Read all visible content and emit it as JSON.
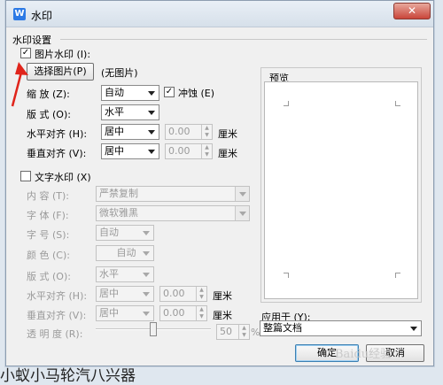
{
  "title": "水印",
  "close_symbol": "✕",
  "app_icon_letter": "W",
  "group_title": "水印设置",
  "picture": {
    "checkbox_label": "图片水印",
    "checkbox_key": "(I):",
    "checked": "✓",
    "select_button": "选择图片",
    "select_key": "(P)",
    "no_picture": "(无图片)",
    "scale_label": "缩 放",
    "scale_key": "(Z):",
    "scale_value": "自动",
    "washout_label": "冲蚀",
    "washout_key": "(E)",
    "layout_label": "版 式",
    "layout_key": "(O):",
    "layout_value": "水平",
    "halign_label": "水平对齐",
    "halign_key": "(H):",
    "halign_value": "居中",
    "halign_offset": "0.00",
    "valign_label": "垂直对齐",
    "valign_key": "(V):",
    "valign_value": "居中",
    "valign_offset": "0.00",
    "unit": "厘米"
  },
  "text": {
    "checkbox_label": "文字水印",
    "checkbox_key": "(X)",
    "content_label": "内 容",
    "content_key": "(T):",
    "content_value": "严禁复制",
    "font_label": "字 体",
    "font_key": "(F):",
    "font_value": "微软雅黑",
    "size_label": "字 号",
    "size_key": "(S):",
    "size_value": "自动",
    "color_label": "颜 色",
    "color_key": "(C):",
    "color_value": "自动",
    "layout_label": "版 式",
    "layout_key": "(O):",
    "layout_value": "水平",
    "halign_label": "水平对齐",
    "halign_key": "(H):",
    "halign_value": "居中",
    "halign_offset": "0.00",
    "valign_label": "垂直对齐",
    "valign_key": "(V):",
    "valign_value": "居中",
    "valign_offset": "0.00",
    "unit": "厘米",
    "transparency_label": "透 明 度",
    "transparency_key": "(R):",
    "transparency_value": "50",
    "transparency_unit": "%",
    "transparency_level": 0.5
  },
  "preview_title": "预览",
  "apply_label": "应用于",
  "apply_key": "(Y):",
  "apply_value": "整篇文档",
  "ok_button": "确定",
  "cancel_button": "取消",
  "watermark_text": "Baidu经验",
  "background_text": "小蚁小马轮汽八兴器",
  "colors": {
    "annotation_arrow": "#e0241b",
    "title_icon": "#2d7ae5",
    "close_button": "#c9453a"
  }
}
